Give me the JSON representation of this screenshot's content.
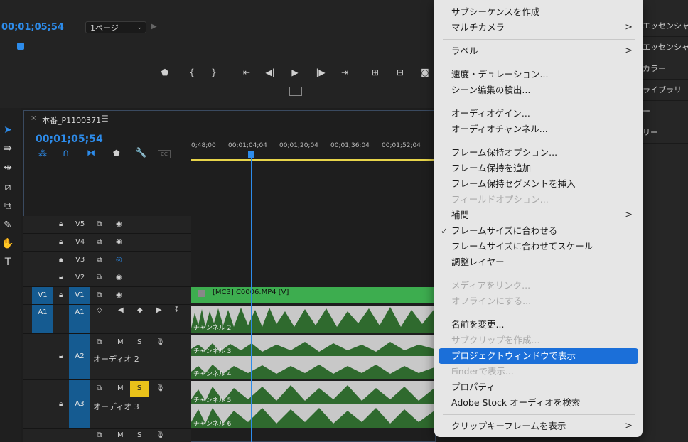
{
  "monitor": {
    "timecode": "00;01;05;54",
    "page_select": "1ページ"
  },
  "sequence": {
    "tab_title": "本番_P1100371",
    "timecode": "00;01;05;54",
    "ruler": [
      "0;48;00",
      "00;01;04;04",
      "00;01;20;04",
      "00;01;36;04",
      "00;01;52;04"
    ],
    "tracks": {
      "video": [
        {
          "name": "V5"
        },
        {
          "name": "V4"
        },
        {
          "name": "V3"
        },
        {
          "name": "V2"
        },
        {
          "name": "V1",
          "source": "V1"
        }
      ],
      "audio": [
        {
          "name": "A1",
          "source": "A1"
        },
        {
          "name": "A2",
          "label": "オーディオ 2"
        },
        {
          "name": "A3",
          "label": "オーディオ 3"
        }
      ]
    },
    "track_buttons": {
      "m": "M",
      "s": "S"
    },
    "clips": {
      "video": "[MC3] C0006.MP4 [V]",
      "ch2": "チャンネル 2",
      "ch3": "チャンネル 3",
      "ch4": "チャンネル 4",
      "ch5": "チャンネル 5",
      "ch6": "チャンネル 6"
    }
  },
  "right_panel": [
    "エッセンシャルグラフィックス",
    "エッセンシャルサウンド",
    "カラー",
    "ライブラリ",
    "ー",
    "リー"
  ],
  "context_menu": {
    "items": [
      {
        "label": "サブシーケンスを作成"
      },
      {
        "label": "マルチカメラ",
        "submenu": ">"
      },
      {
        "label": "ラベル",
        "submenu": ">"
      },
      {
        "label": "速度・デュレーション..."
      },
      {
        "label": "シーン編集の検出..."
      },
      {
        "label": "オーディオゲイン..."
      },
      {
        "label": "オーディオチャンネル..."
      },
      {
        "label": "フレーム保持オプション..."
      },
      {
        "label": "フレーム保持を追加"
      },
      {
        "label": "フレーム保持セグメントを挿入"
      },
      {
        "label": "フィールドオプション...",
        "disabled": true
      },
      {
        "label": "補間",
        "submenu": ">"
      },
      {
        "label": "フレームサイズに合わせる",
        "checked": "✓"
      },
      {
        "label": "フレームサイズに合わせてスケール"
      },
      {
        "label": "調整レイヤー"
      },
      {
        "label": "メディアをリンク...",
        "disabled": true
      },
      {
        "label": "オフラインにする...",
        "disabled": true
      },
      {
        "label": "名前を変更..."
      },
      {
        "label": "サブクリップを作成...",
        "disabled": true
      },
      {
        "label": "プロジェクトウィンドウで表示",
        "highlighted": true
      },
      {
        "label": "Finderで表示...",
        "disabled": true
      },
      {
        "label": "プロパティ"
      },
      {
        "label": "Adobe Stock オーディオを検索"
      },
      {
        "label": "クリップキーフレームを表示",
        "submenu": ">"
      }
    ]
  },
  "colors": {
    "accent": "#2d8ceb",
    "clip_green": "#3dad4f",
    "highlight": "#1b6fd9",
    "solo": "#e9c21a"
  }
}
